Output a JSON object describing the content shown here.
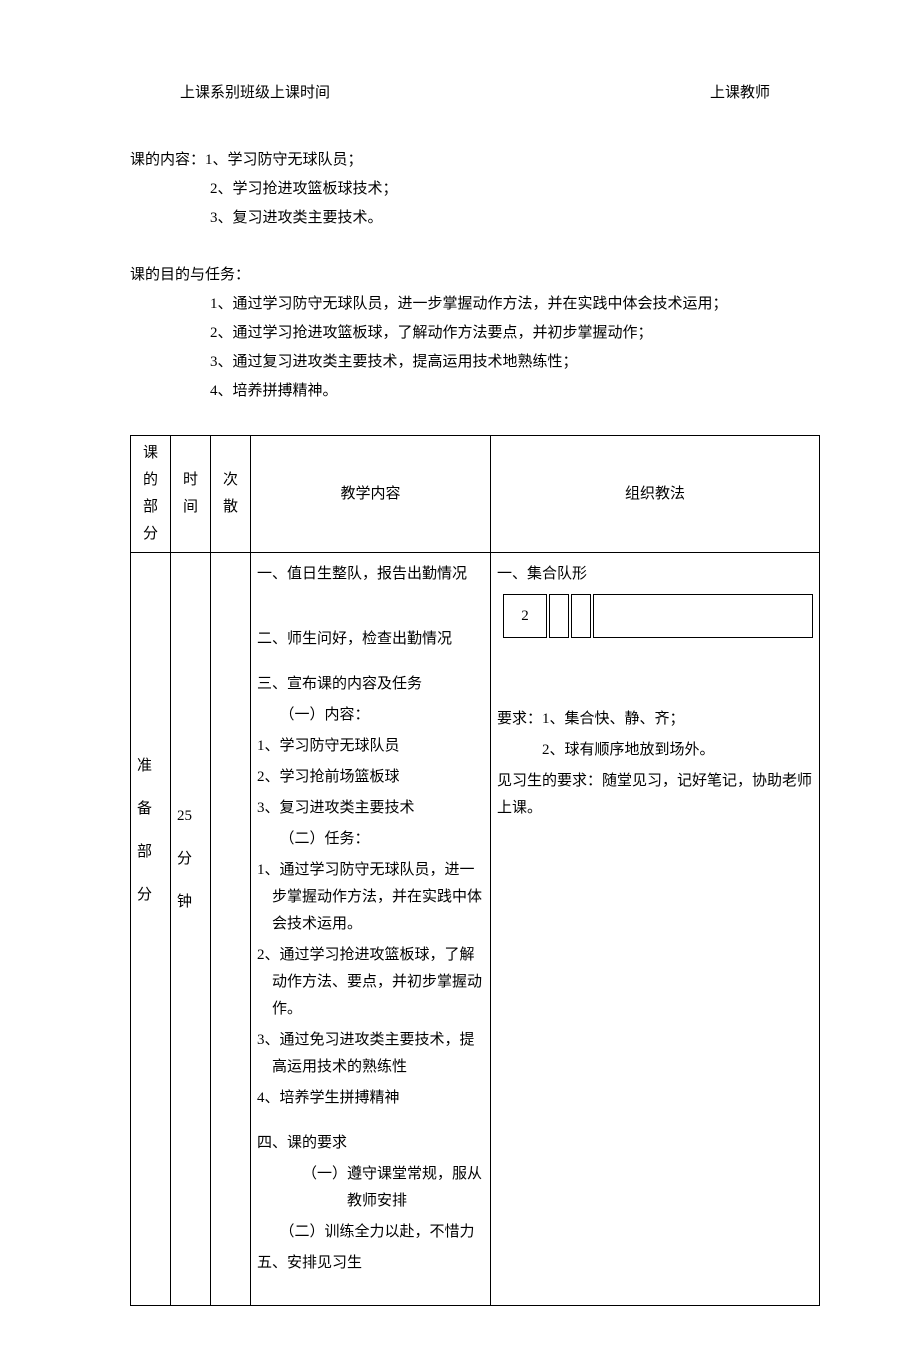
{
  "header": {
    "left": "上课系别班级上课时间",
    "right": "上课教师"
  },
  "content": {
    "label": "课的内容：",
    "items": [
      "1、学习防守无球队员；",
      "2、学习抢进攻篮板球技术；",
      "3、复习进攻类主要技术。"
    ]
  },
  "purpose": {
    "label": "课的目的与任务：",
    "items": [
      "1、通过学习防守无球队员，进一步掌握动作方法，并在实践中体会技术运用；",
      "2、通过学习抢进攻篮板球，了解动作方法要点，并初步掌握动作；",
      "3、通过复习进攻类主要技术，提高运用技术地熟练性；",
      "4、培养拼搏精神。"
    ]
  },
  "table": {
    "headers": {
      "part": "课的部分",
      "time": "时间",
      "ci": "次散",
      "content": "教学内容",
      "method": "组织教法"
    },
    "row": {
      "part": [
        "准",
        "备",
        "部",
        "分"
      ],
      "time": [
        "25",
        "分",
        "钟"
      ],
      "ci": "",
      "content": {
        "l1": "一、值日生整队，报告出勤情况",
        "l2": "二、师生问好，检查出勤情况",
        "l3": "三、宣布课的内容及任务",
        "l3a": "（一）内容：",
        "l3a1": "1、学习防守无球队员",
        "l3a2": "2、学习抢前场篮板球",
        "l3a3": "3、复习进攻类主要技术",
        "l3b": "（二）任务：",
        "l3b1": "1、通过学习防守无球队员，进一步掌握动作方法，并在实践中体会技术运用。",
        "l3b2": "2、通过学习抢进攻篮板球，了解动作方法、要点，并初步掌握动作。",
        "l3b3": "3、通过免习进攻类主要技术，提高运用技术的熟练性",
        "l3b4": "4、培养学生拼搏精神",
        "l4": "四、课的要求",
        "l4a": "（一）遵守课堂常规，服从教师安排",
        "l4b": "（二）训练全力以赴，不惜力",
        "l5": "五、安排见习生"
      },
      "method": {
        "m1": "一、集合队形",
        "box": "2",
        "m2": "要求：1、集合快、静、齐；",
        "m2b": "2、球有顺序地放到场外。",
        "m3": "见习生的要求：随堂见习，记好笔记，协助老师上课。"
      }
    }
  }
}
